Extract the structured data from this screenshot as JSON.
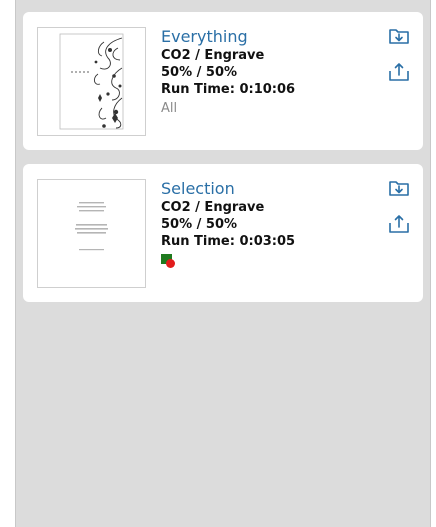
{
  "jobs": [
    {
      "title": "Everything",
      "material": "CO2 / Engrave",
      "power_speed": "50% / 50%",
      "run_time": "Run Time: 0:10:06",
      "scope": "All",
      "thumbnail": "floral-swirl-design"
    },
    {
      "title": "Selection",
      "material": "CO2 / Engrave",
      "power_speed": "50% / 50%",
      "run_time": "Run Time: 0:03:05",
      "color_indicator": {
        "square": "#1f7a1f",
        "dot": "#e21c1c"
      },
      "thumbnail": "text-card-design"
    }
  ],
  "icons": {
    "download": "folder-download-icon",
    "upload": "tray-upload-icon"
  },
  "colors": {
    "accent": "#2a6fa6",
    "panel_bg": "#dcdcdc",
    "card_bg": "#ffffff"
  }
}
